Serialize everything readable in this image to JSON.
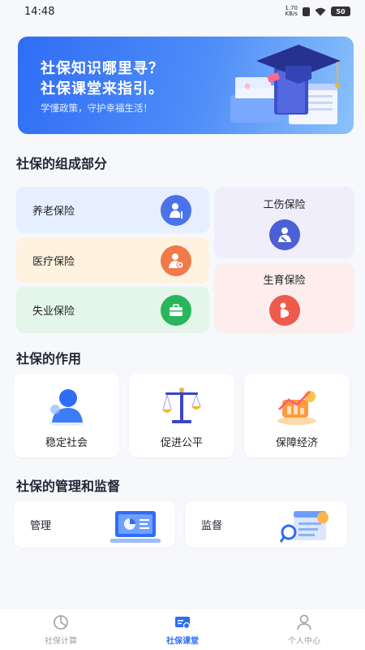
{
  "status_bar": {
    "time": "14:48",
    "net_speed_value": "1.70",
    "net_speed_unit": "KB/s",
    "battery": "50"
  },
  "banner": {
    "line1": "社保知识哪里寻？",
    "line2": "社保课堂来指引。",
    "subtitle": "学懂政策，守护幸福生活！"
  },
  "composition": {
    "title": "社保的组成部分",
    "items": [
      {
        "label": "养老保险",
        "icon": "elderly-person-icon"
      },
      {
        "label": "医疗保险",
        "icon": "medical-person-icon"
      },
      {
        "label": "失业保险",
        "icon": "briefcase-icon"
      },
      {
        "label": "工伤保险",
        "icon": "injured-person-icon"
      },
      {
        "label": "生育保险",
        "icon": "pregnancy-icon"
      }
    ]
  },
  "roles": {
    "title": "社保的作用",
    "items": [
      {
        "label": "稳定社会",
        "icon": "person-silhouette-icon"
      },
      {
        "label": "促进公平",
        "icon": "scale-icon"
      },
      {
        "label": "保障经济",
        "icon": "economy-chart-icon"
      }
    ]
  },
  "management": {
    "title": "社保的管理和监督",
    "items": [
      {
        "label": "管理",
        "icon": "monitor-chart-icon"
      },
      {
        "label": "监督",
        "icon": "document-review-icon"
      }
    ]
  },
  "tab_bar": {
    "items": [
      {
        "label": "社保计算",
        "icon": "calculator-icon",
        "active": false
      },
      {
        "label": "社保课堂",
        "icon": "classroom-icon",
        "active": true
      },
      {
        "label": "个人中心",
        "icon": "person-icon",
        "active": false
      }
    ]
  },
  "colors": {
    "accent": "#2f6df6",
    "pension_bg": "#e6efff",
    "pension_icon": "#4b72e8",
    "medical_bg": "#fff3e0",
    "medical_icon": "#f07a4a",
    "unemployment_bg": "#e4f5ea",
    "unemployment_icon": "#28b55c",
    "injury_bg": "#f1eefc",
    "injury_icon": "#4b5fd6",
    "maternity_bg": "#fdeeed",
    "maternity_icon": "#ee5a4c"
  }
}
